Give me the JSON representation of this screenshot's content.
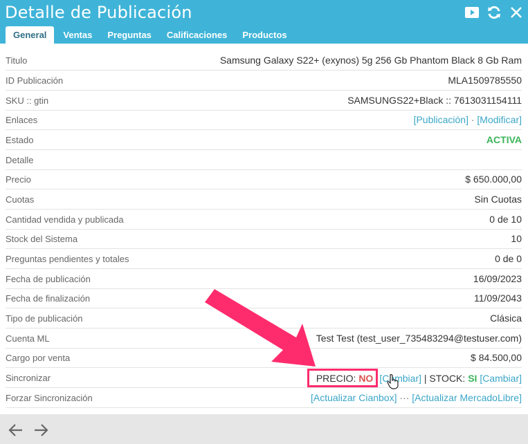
{
  "window": {
    "title": "Detalle de Publicación"
  },
  "tabs": [
    {
      "label": "General",
      "active": true
    },
    {
      "label": "Ventas"
    },
    {
      "label": "Preguntas"
    },
    {
      "label": "Calificaciones"
    },
    {
      "label": "Productos"
    }
  ],
  "details": {
    "titulo": {
      "label": "Titulo",
      "value": "Samsung Galaxy S22+ (exynos) 5g 256 Gb Phantom Black 8 Gb Ram"
    },
    "id": {
      "label": "ID Publicación",
      "value": "MLA1509785550"
    },
    "sku": {
      "label": "SKU :: gtin",
      "value": "SAMSUNGS22+Black :: 7613031154111"
    },
    "enlaces": {
      "label": "Enlaces",
      "link1": "[Publicación]",
      "sep": " · ",
      "link2": "[Modificar]"
    },
    "estado": {
      "label": "Estado",
      "value": "ACTIVA"
    },
    "detalle": {
      "label": "Detalle",
      "value": ""
    },
    "precio": {
      "label": "Precio",
      "value": "$ 650.000,00"
    },
    "cuotas": {
      "label": "Cuotas",
      "value": "Sin Cuotas"
    },
    "cantidad": {
      "label": "Cantidad vendida y publicada",
      "value": "0 de 10"
    },
    "stock": {
      "label": "Stock del Sistema",
      "value": "10"
    },
    "preguntas": {
      "label": "Preguntas pendientes y totales",
      "value": "0 de 0"
    },
    "fecha_pub": {
      "label": "Fecha de publicación",
      "value": "16/09/2023"
    },
    "fecha_fin": {
      "label": "Fecha de finalización",
      "value": "11/09/2043"
    },
    "tipo": {
      "label": "Tipo de publicación",
      "value": "Clásica"
    },
    "cuenta": {
      "label": "Cuenta ML",
      "value": "Test Test (test_user_735483294@testuser.com)"
    },
    "cargo": {
      "label": "Cargo por venta",
      "value": "$ 84.500,00"
    },
    "sincronizar": {
      "label": "Sincronizar",
      "precio_label": "PRECIO: ",
      "precio_value": "NO",
      "cambiar1": "[Cambiar]",
      "pipe": " | ",
      "stock_label": "STOCK: ",
      "stock_value": "SI",
      "cambiar2": "[Cambiar]"
    },
    "forzar": {
      "label": "Forzar Sincronización",
      "link1": "[Actualizar Cianbox]",
      "sep": " ··· ",
      "link2": "[Actualizar MercadoLibre]"
    }
  },
  "icons": {
    "video": "youtube-icon",
    "refresh": "refresh-icon",
    "close": "close-icon",
    "back": "arrow-left-icon",
    "forward": "arrow-right-icon"
  },
  "colors": {
    "header": "#3fb4d8",
    "link": "#3aa6c7",
    "active": "#3cb55a",
    "no": "#d9534f",
    "highlight": "#ff2c6d"
  }
}
